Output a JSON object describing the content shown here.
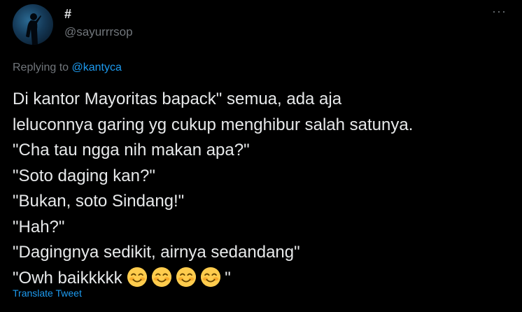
{
  "user": {
    "display_name": "#",
    "handle": "@sayurrrsop"
  },
  "more_menu": "···",
  "reply": {
    "prefix": "Replying to ",
    "mention": "@kantyca"
  },
  "tweet_lines": [
    "Di kantor Mayoritas bapack\" semua, ada aja",
    "leluconnya garing yg cukup menghibur salah satunya.",
    "\"Cha tau ngga nih makan apa?\"",
    "\"Soto daging kan?\"",
    "\"Bukan, soto Sindang!\"",
    "\"Hah?\"",
    "\"Dagingnya sedikit, airnya sedandang\""
  ],
  "last_line": {
    "prefix": "\"Owh baikkkkk ",
    "emojis": [
      "smiling-face-with-smiling-eyes-icon",
      "smiling-face-with-smiling-eyes-icon",
      "smiling-face-with-smiling-eyes-icon",
      "smiling-face-with-smiling-eyes-icon"
    ],
    "suffix": "\""
  },
  "translate_label": "Translate Tweet",
  "colors": {
    "background": "#000000",
    "text": "#e7e9ea",
    "muted": "#71767b",
    "link": "#1d9bf0"
  }
}
